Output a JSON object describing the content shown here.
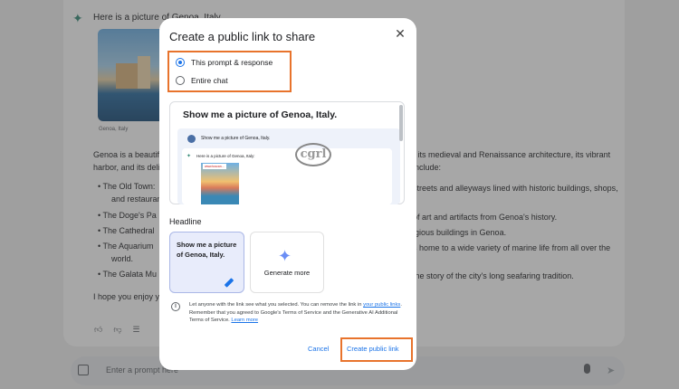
{
  "chat": {
    "intro": "Here is a picture of Genoa, Italy.",
    "photo_caption": "Genoa, Italy",
    "para1_left": "Genoa is a beautiful",
    "para1_right": "r its medieval and Renaissance architecture, its vibrant",
    "para2_left": "harbor, and its delic",
    "para2_right": "include:",
    "bullets": [
      {
        "left": "The Old Town:",
        "right": "streets and alleyways lined with historic buildings, shops,"
      },
      {
        "left": "and restaurant",
        "right": ""
      },
      {
        "left": "The Doge's Pa",
        "right": "of art and artifacts from Genoa's history."
      },
      {
        "left": "The Cathedral",
        "right": "igious buildings in Genoa."
      },
      {
        "left": "The Aquarium",
        "right": "s home to a wide variety of marine life from all over the"
      },
      {
        "left": "world.",
        "right": ""
      },
      {
        "left": "The Galata Mu",
        "right": "the story of the city's long seafaring tradition."
      }
    ],
    "closing": "I hope you enjoy yo",
    "prompt_placeholder": "Enter a prompt here"
  },
  "modal": {
    "title": "Create a public link to share",
    "options": [
      {
        "label": "This prompt & response",
        "selected": true
      },
      {
        "label": "Entire chat",
        "selected": false
      }
    ],
    "preview": {
      "title": "Show me a picture of Genoa, Italy.",
      "prompt": "Show me a picture of Genoa, Italy.",
      "response": "Here is a picture of Genoa, Italy:",
      "image_label": "www.tuscan...",
      "logo_text": "cgrl"
    },
    "headline_label": "Headline",
    "headline_card": "Show me a picture of Genoa, Italy.",
    "generate_label": "Generate more",
    "info": {
      "part1": "Let anyone with the link see what you selected. You can remove the link in ",
      "link1": "your public links",
      "part2": ". Remember that you agreed to Google's Terms of Service and the Generative AI Additional Terms of Service. ",
      "link2": "Learn more"
    },
    "cancel_label": "Cancel",
    "create_label": "Create public link"
  },
  "colors": {
    "accent": "#1a73e8",
    "highlight": "#e8732c"
  }
}
